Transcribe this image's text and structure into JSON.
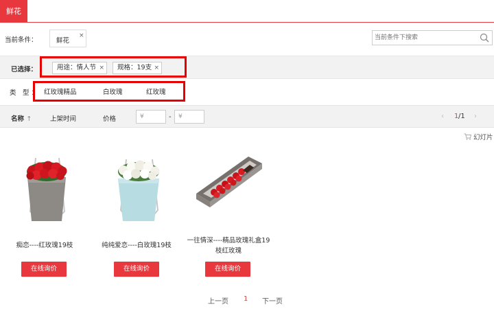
{
  "header": {
    "active_tab": "鲜花"
  },
  "conditions": {
    "label": "当前条件：",
    "tag": "鲜花",
    "close": "×",
    "search_placeholder": "当前条件下搜索"
  },
  "selected": {
    "label": "已选择：",
    "tags": [
      {
        "text": "用途：情人节",
        "close": "×"
      },
      {
        "text": "规格：19支",
        "close": "×"
      }
    ]
  },
  "types": {
    "label": "类　型 ：",
    "items": [
      "红玫瑰精品",
      "白玫瑰",
      "红玫瑰"
    ]
  },
  "sort": {
    "name": "名称",
    "name_arrow": "↑",
    "time": "上架时间",
    "price": "价格",
    "price_from": "¥",
    "price_to": "¥",
    "dash": "-",
    "pager": {
      "prev": "‹",
      "current": "1",
      "total": "/1",
      "next": "›"
    }
  },
  "view": {
    "slideshow": "幻灯片"
  },
  "products": [
    {
      "name": "痴恋----红玫瑰19枝",
      "button": "在线询价"
    },
    {
      "name": "纯纯爱恋----白玫瑰19枝",
      "button": "在线询价"
    },
    {
      "name": "一往情深----精品玫瑰礼盒19枝红玫瑰",
      "button": "在线询价"
    }
  ],
  "pagination": {
    "prev": "上一页",
    "current": "1",
    "next": "下一页"
  },
  "colors": {
    "accent": "#e8383d",
    "highlight_box": "#e60000"
  }
}
